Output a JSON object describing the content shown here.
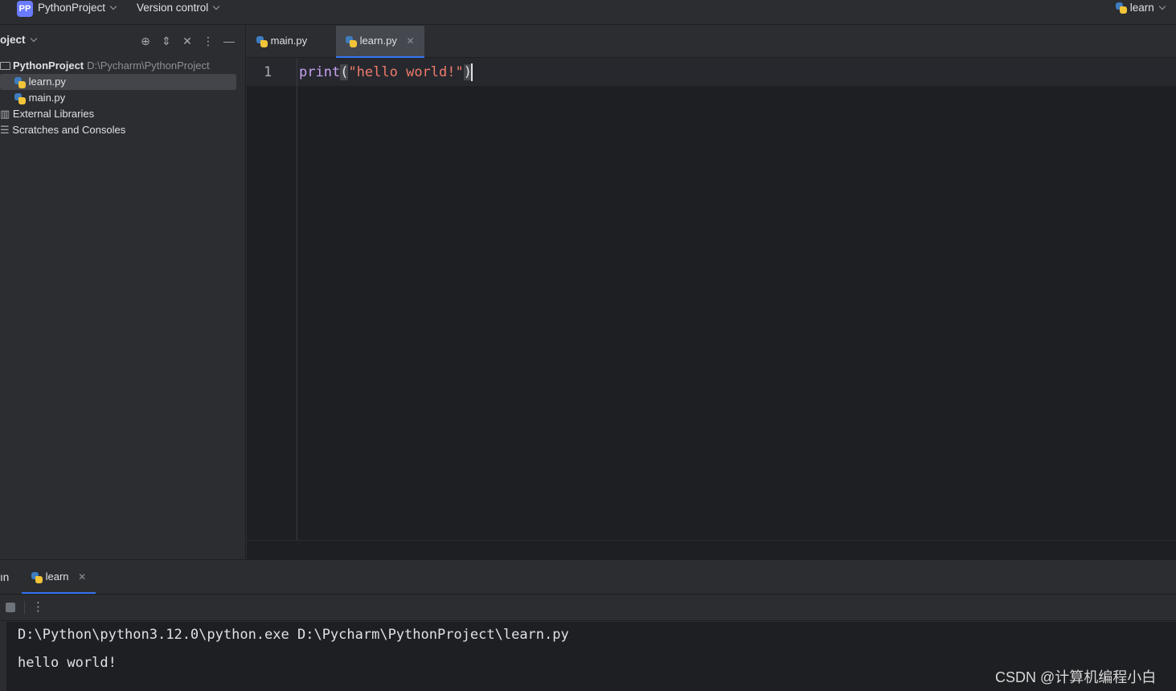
{
  "titlebar": {
    "project_badge": "PP",
    "project_name": "PythonProject",
    "version_control": "Version control",
    "run_config": "learn"
  },
  "project_panel": {
    "title": "oject",
    "tree": {
      "root_name": "PythonProject",
      "root_path": "D:\\Pycharm\\PythonProject",
      "files": [
        "learn.py",
        "main.py"
      ],
      "external_libraries": "External Libraries",
      "scratches": "Scratches and Consoles"
    }
  },
  "editor": {
    "tabs": [
      {
        "label": "main.py",
        "active": false
      },
      {
        "label": "learn.py",
        "active": true
      }
    ],
    "line_number": "1",
    "code": {
      "fn": "print",
      "open_paren": "(",
      "string": "\"hello world!\"",
      "close_paren": ")"
    }
  },
  "run_panel": {
    "label": "ın",
    "tab_label": "learn",
    "console": [
      "D:\\Python\\python3.12.0\\python.exe D:\\Pycharm\\PythonProject\\learn.py",
      "hello world!"
    ]
  },
  "watermark": "CSDN @计算机编程小白",
  "icons": {
    "locate": "crosshair-icon",
    "expand": "expand-icon",
    "collapse": "collapse-icon",
    "options": "more-vertical-icon",
    "hide": "minimize-icon"
  },
  "colors": {
    "accent": "#3574f0",
    "function": "#c8a2f0",
    "string": "#f07a6a",
    "badge": "#6b7bff"
  }
}
